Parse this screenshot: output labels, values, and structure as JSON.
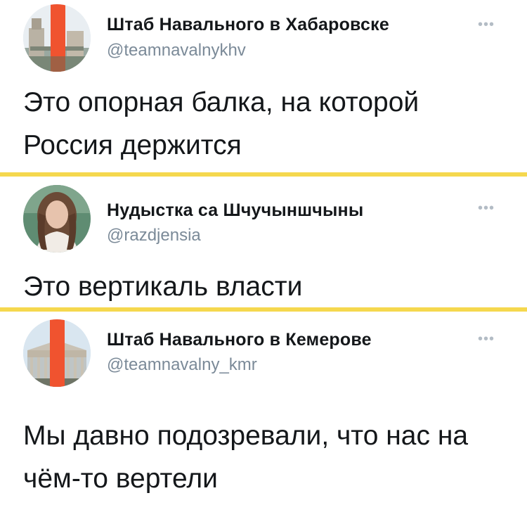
{
  "tweets": [
    {
      "author_name": "Штаб Навального в Хабаровске",
      "handle": "@teamnavalnykhv",
      "more_icon": "more-dots-icon",
      "text_lines": [
        "Это опорная балка, на которой",
        "Россия держится"
      ],
      "avatar": "building-with-red-stripe"
    },
    {
      "author_name": "Нудыстка са Шчучыншчыны",
      "handle": "@razdjensia",
      "more_icon": "more-dots-icon",
      "text_lines": [
        "Это вертикаль власти"
      ],
      "avatar": "woman-portrait"
    },
    {
      "author_name": "Штаб Навального в Кемерове",
      "handle": "@teamnavalny_kmr",
      "more_icon": "more-dots-icon",
      "text_lines": [
        "Мы давно подозревали, что нас на",
        "чём-то вертели"
      ],
      "avatar": "theatre-with-red-stripe"
    }
  ],
  "colors": {
    "divider": "#f5d84e",
    "accent_stripe": "#f0532f",
    "handle": "#7b8a98",
    "more_dots": "#b3bcc5"
  }
}
